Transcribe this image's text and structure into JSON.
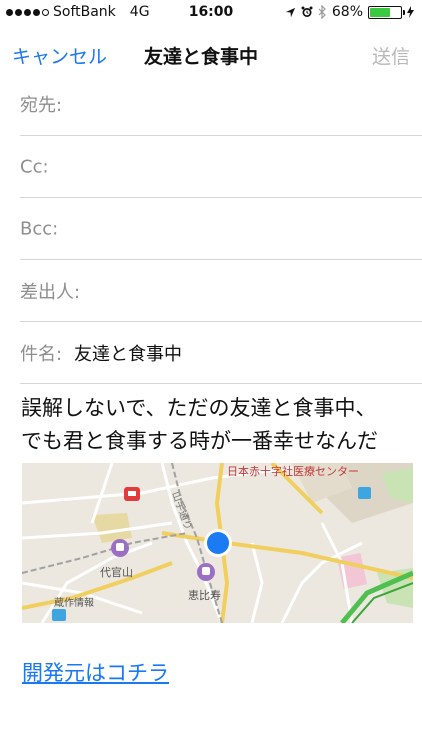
{
  "status": {
    "carrier": "SoftBank",
    "network": "4G",
    "time": "16:00",
    "battery": "68%",
    "battery_level": 0.68
  },
  "nav": {
    "cancel": "キャンセル",
    "title": "友達と食事中",
    "send": "送信"
  },
  "fields": {
    "to": "宛先:",
    "cc": "Cc:",
    "bcc": "Bcc:",
    "from": "差出人:",
    "subject_label": "件名:",
    "subject_value": "友達と食事中"
  },
  "message": {
    "line1": "誤解しないで、ただの友達と食事中、",
    "line2": "でも君と食事する時が一番幸せなんだ"
  },
  "map": {
    "labels": {
      "hospital": "日本赤十字社医療センター",
      "daikanyama": "代官山",
      "ebisu": "恵比寿",
      "street": "山手通り",
      "info": "蔵作情報"
    }
  },
  "link": "開発元はコチラ",
  "colors": {
    "accent": "#1a78f0",
    "disabled": "#b9b9b9",
    "battery": "#3ac940",
    "pin": "#1a7bf2"
  }
}
